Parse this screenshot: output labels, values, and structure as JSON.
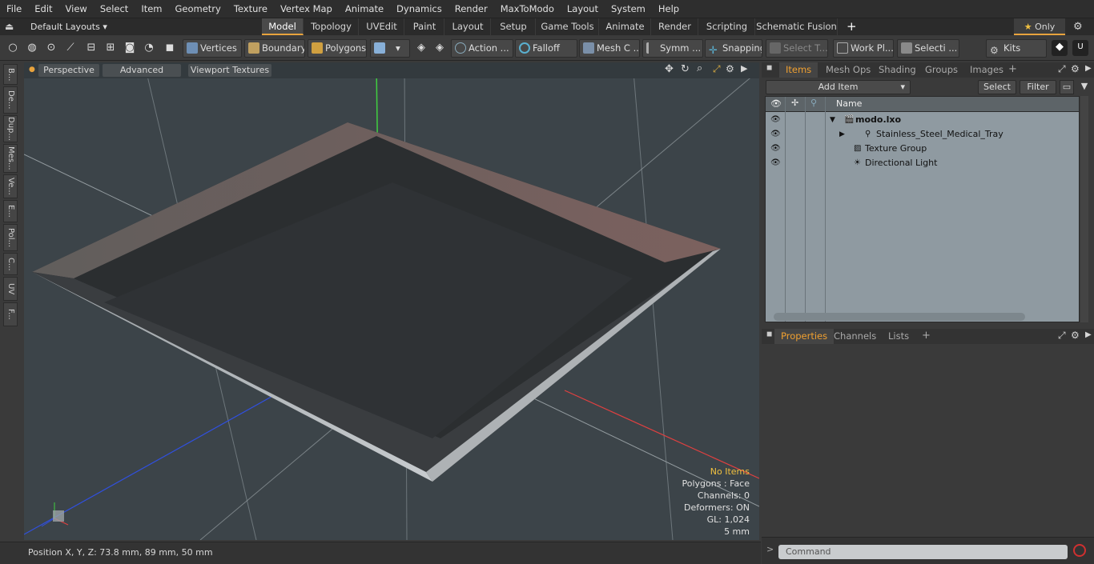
{
  "menu": [
    "File",
    "Edit",
    "View",
    "Select",
    "Item",
    "Geometry",
    "Texture",
    "Vertex Map",
    "Animate",
    "Dynamics",
    "Render",
    "MaxToModo",
    "Layout",
    "System",
    "Help"
  ],
  "layout_selector": "Default Layouts",
  "mode_tabs": [
    {
      "label": "Model",
      "active": true
    },
    {
      "label": "Topology"
    },
    {
      "label": "UVEdit"
    },
    {
      "label": "Paint"
    },
    {
      "label": "Layout"
    },
    {
      "label": "Setup"
    },
    {
      "label": "Game Tools"
    },
    {
      "label": "Animate"
    },
    {
      "label": "Render"
    },
    {
      "label": "Scripting"
    },
    {
      "label": "Schematic Fusion"
    }
  ],
  "only_label": "Only",
  "toolbar": {
    "vertices": "Vertices",
    "boundary": "Boundary",
    "polygons": "Polygons",
    "action": "Action",
    "falloff": "Falloff",
    "mesh": "Mesh C ...",
    "symm": "Symm ...",
    "snapping": "Snapping",
    "select_t": "Select T...",
    "work_plane": "Work Pl...",
    "selecti": "Selecti ...",
    "kits": "Kits"
  },
  "left_tabs": [
    "B...",
    "De...",
    "Dup...",
    "Mes...",
    "Ve...",
    "E...",
    "Pol...",
    "C...",
    "UV",
    "F..."
  ],
  "viewport": {
    "perspective": "Perspective",
    "advanced": "Advanced",
    "textures": "Viewport Textures",
    "stats": {
      "no_items": "No Items",
      "polygons": "Polygons : Face",
      "channels": "Channels: 0",
      "deformers": "Deformers: ON",
      "gl": "GL: 1,024",
      "scale": "5 mm"
    }
  },
  "status": {
    "position": "Position X, Y, Z:  73.8 mm, 89 mm, 50 mm"
  },
  "panel": {
    "tabs": [
      "Items",
      "Mesh Ops",
      "Shading",
      "Groups",
      "Images"
    ],
    "add_item": "Add Item",
    "select": "Select",
    "filter": "Filter",
    "name_header": "Name",
    "items": [
      {
        "label": "modo.lxo",
        "bold": true
      },
      {
        "label": "Stainless_Steel_Medical_Tray"
      },
      {
        "label": "Texture Group"
      },
      {
        "label": "Directional Light"
      }
    ],
    "prop_tabs": [
      "Properties",
      "Channels",
      "Lists"
    ]
  },
  "command_placeholder": "Command"
}
